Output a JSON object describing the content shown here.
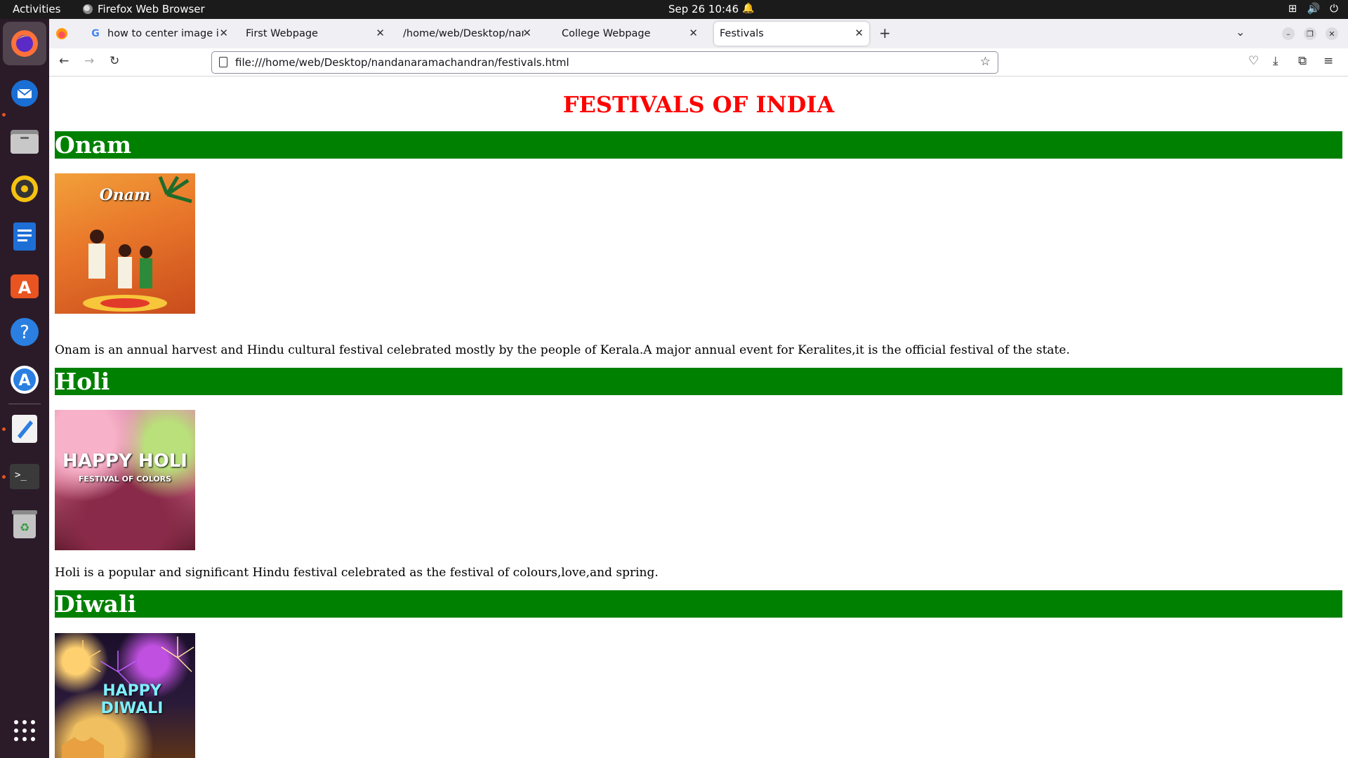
{
  "topbar": {
    "activities": "Activities",
    "app_name": "Firefox Web Browser",
    "datetime": "Sep 26  10:46"
  },
  "dock": {
    "apps": [
      "firefox-icon",
      "thunderbird-icon",
      "files-icon",
      "rhythmbox-icon",
      "writer-icon",
      "app-center-icon",
      "help-icon",
      "software-updater-icon",
      "text-editor-icon",
      "terminal-icon",
      "trash-icon",
      "show-apps-icon"
    ]
  },
  "tabs": [
    {
      "title": "how to center image in h",
      "favicon": "google-icon"
    },
    {
      "title": "First Webpage"
    },
    {
      "title": "/home/web/Desktop/nandar"
    },
    {
      "title": "College Webpage"
    },
    {
      "title": "Festivals",
      "selected": true
    }
  ],
  "urlbar": {
    "url": "file:///home/web/Desktop/nandanaramachandran/festivals.html"
  },
  "page": {
    "title": "FESTIVALS OF INDIA",
    "sections": [
      {
        "heading": "Onam",
        "image_label": "Onam",
        "text": "Onam is an annual harvest and Hindu cultural festival celebrated mostly by the people of Kerala.A major annual event for Keralites,it is the official festival of the state."
      },
      {
        "heading": "Holi",
        "image_label": "HAPPY HOLI",
        "image_sublabel": "FESTIVAL OF COLORS",
        "text": "Holi is a popular and significant Hindu festival celebrated as the festival of colours,love,and spring."
      },
      {
        "heading": "Diwali",
        "image_label": "HAPPY DIWALI"
      }
    ]
  },
  "colors": {
    "title": "#ff0000",
    "section_band": "#008000",
    "dock_bg": "#2b1b29",
    "topbar_bg": "#1b1b1b"
  }
}
